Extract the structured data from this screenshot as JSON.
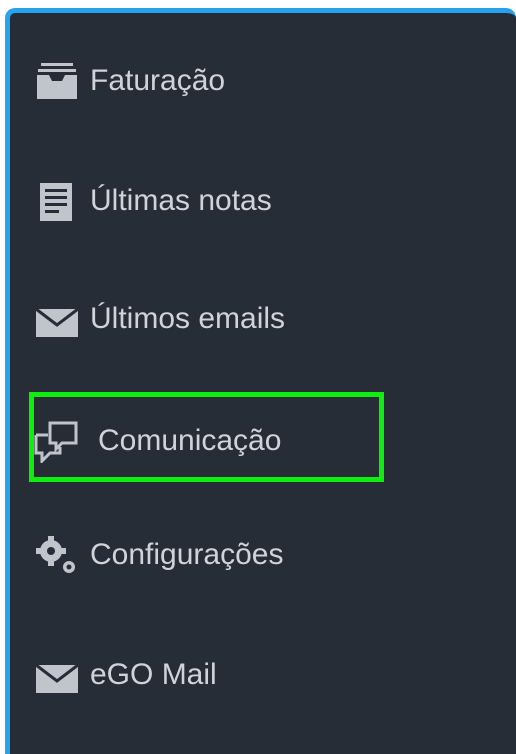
{
  "menu": {
    "items": [
      {
        "label": "Faturação",
        "icon": "archive-tray-icon"
      },
      {
        "label": "Últimas notas",
        "icon": "note-document-icon"
      },
      {
        "label": "Últimos emails",
        "icon": "envelope-icon"
      },
      {
        "label": "Comunicação",
        "icon": "chat-bubbles-icon"
      },
      {
        "label": "Configurações",
        "icon": "gears-icon"
      },
      {
        "label": "eGO Mail",
        "icon": "envelope-icon"
      }
    ],
    "highlighted_item": "Comunicação"
  },
  "colors": {
    "panel_background": "#272d37",
    "panel_border": "#27a3ee",
    "text": "#cfd4da",
    "icon": "#c0c5cc",
    "highlight": "#10ee10"
  }
}
